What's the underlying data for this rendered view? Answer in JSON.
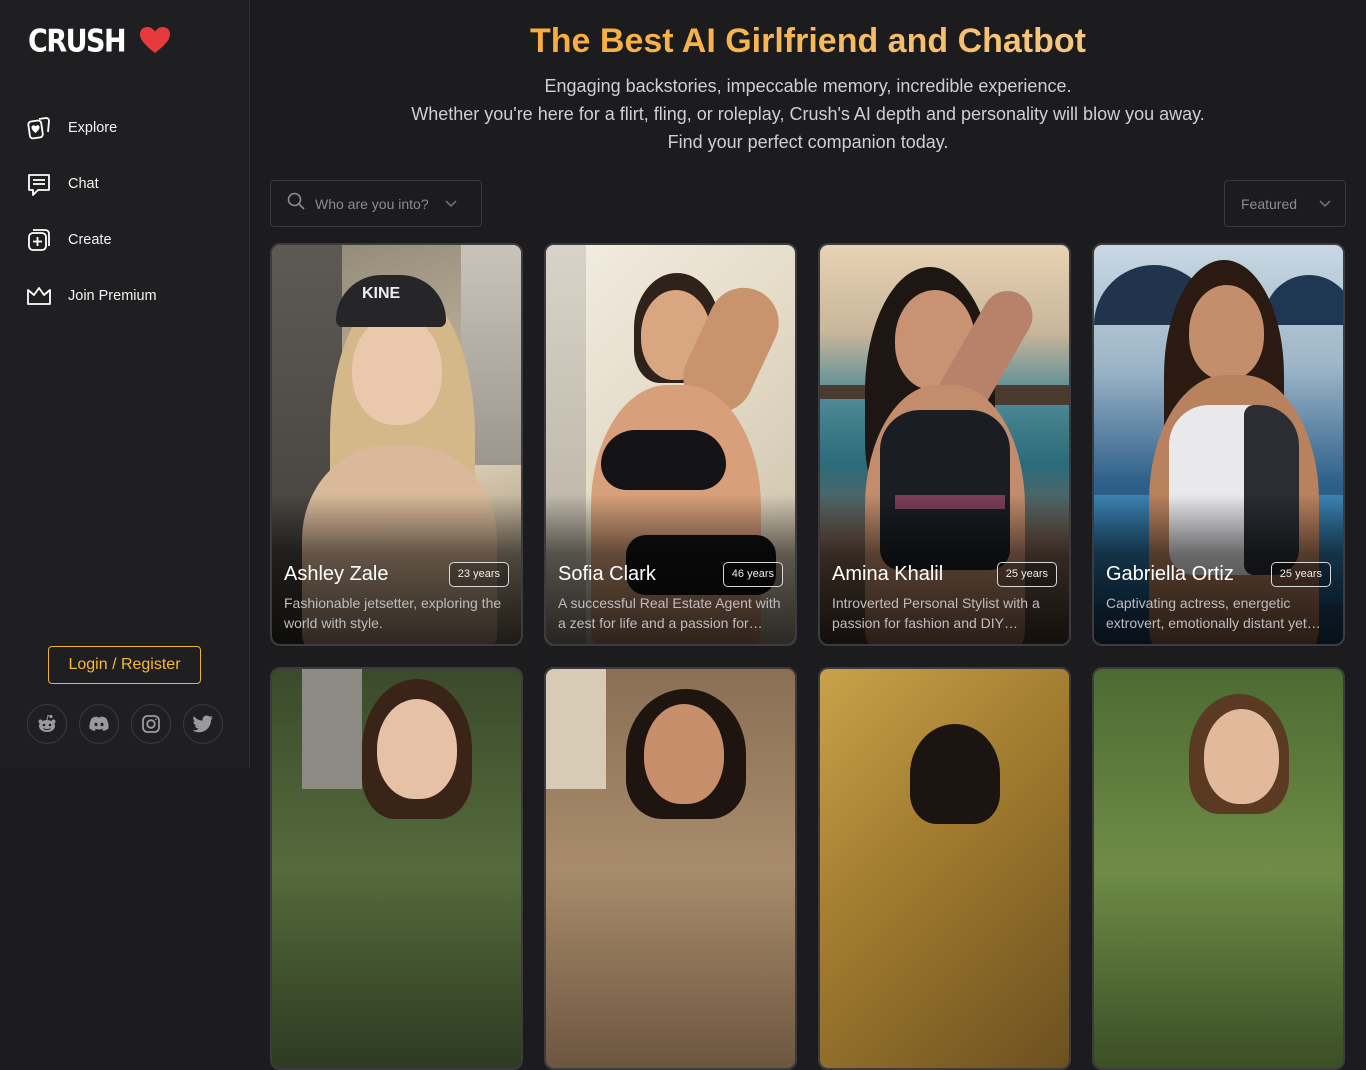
{
  "brand": {
    "name": "CRUSH"
  },
  "sidebar": {
    "nav": [
      {
        "label": "Explore",
        "icon": "explore-icon"
      },
      {
        "label": "Chat",
        "icon": "chat-icon"
      },
      {
        "label": "Create",
        "icon": "create-icon"
      },
      {
        "label": "Join Premium",
        "icon": "crown-icon"
      }
    ],
    "login_label": "Login / Register",
    "socials": [
      "reddit-icon",
      "discord-icon",
      "instagram-icon",
      "twitter-icon"
    ]
  },
  "hero": {
    "title": "The Best AI Girlfriend and Chatbot",
    "lines": [
      "Engaging backstories, impeccable memory, incredible experience.",
      "Whether you're here for a flirt, fling, or roleplay, Crush's AI depth and personality will blow you away.",
      "Find your perfect companion today."
    ]
  },
  "search": {
    "placeholder": "Who are you into?"
  },
  "sort": {
    "selected": "Featured"
  },
  "colors": {
    "accent": "#f5a623",
    "heart": "#e8393f",
    "background": "#1c1c1e",
    "sidebar": "#1f1f21"
  },
  "cards": [
    {
      "name": "Ashley Zale",
      "age": "23 years",
      "description": "Fashionable jetsetter, exploring the world with style."
    },
    {
      "name": "Sofia Clark",
      "age": "46 years",
      "description": "A successful Real Estate Agent with a zest for life and a passion for…"
    },
    {
      "name": "Amina Khalil",
      "age": "25 years",
      "description": "Introverted Personal Stylist with a passion for fashion and DIY…"
    },
    {
      "name": "Gabriella Ortiz",
      "age": "25 years",
      "description": "Captivating actress, energetic extrovert, emotionally distant yet…"
    },
    {
      "name": "",
      "age": "",
      "description": ""
    },
    {
      "name": "",
      "age": "",
      "description": ""
    },
    {
      "name": "",
      "age": "",
      "description": ""
    },
    {
      "name": "",
      "age": "",
      "description": ""
    }
  ]
}
